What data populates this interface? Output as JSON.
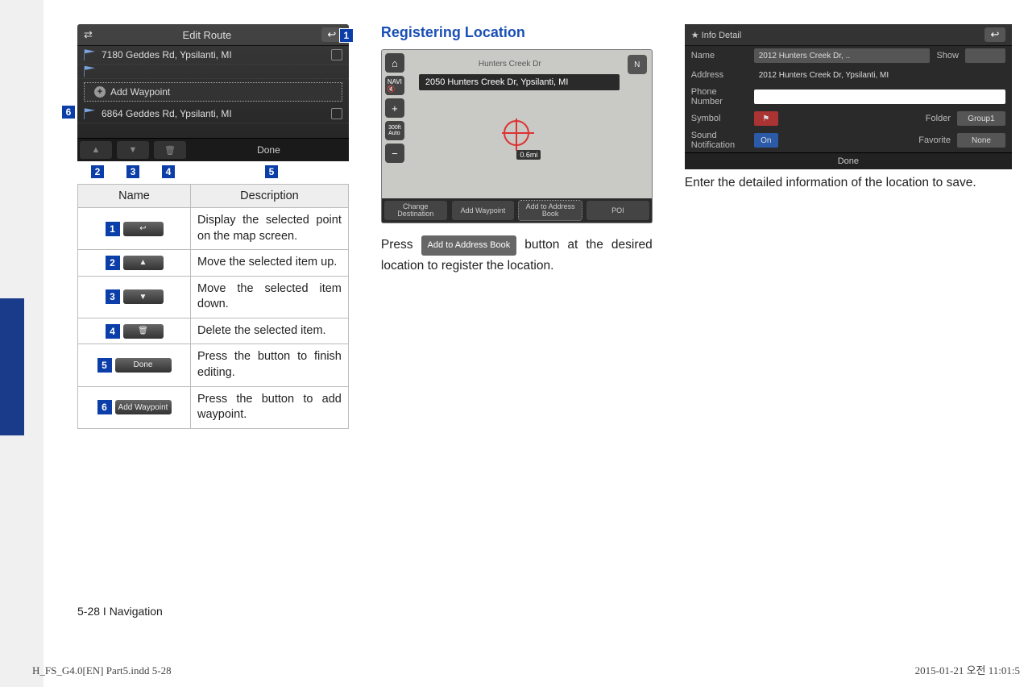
{
  "col1": {
    "edit_route": {
      "title": "Edit Route",
      "row1": "7180 Geddes Rd, Ypsilanti, MI",
      "add_waypoint": "Add Waypoint",
      "row3": "6864 Geddes Rd, Ypsilanti, MI",
      "done": "Done"
    },
    "callouts": {
      "c1": "1",
      "c2": "2",
      "c3": "3",
      "c4": "4",
      "c5": "5",
      "c6": "6"
    },
    "table": {
      "h_name": "Name",
      "h_desc": "Description",
      "rows": [
        {
          "n": "1",
          "btn_icon": "↩",
          "btn_text": "",
          "desc": "Display the selected point on the map screen."
        },
        {
          "n": "2",
          "btn_icon": "▲",
          "btn_text": "",
          "desc": "Move the selected item up."
        },
        {
          "n": "3",
          "btn_icon": "▼",
          "btn_text": "",
          "desc": "Move the selected item down."
        },
        {
          "n": "4",
          "btn_icon": "🗑",
          "btn_text": "",
          "desc": "Delete the selected item."
        },
        {
          "n": "5",
          "btn_icon": "",
          "btn_text": "Done",
          "desc": "Press the button to finish editing."
        },
        {
          "n": "6",
          "btn_icon": "",
          "btn_text": "Add Waypoint",
          "desc": "Press the button to add waypoint."
        }
      ]
    }
  },
  "col2": {
    "heading": "Registering Location",
    "map": {
      "road": "Hunters Creek Dr",
      "addr": "2050 Hunters Creek Dr, Ypsilanti, MI",
      "dist": "0.6mi",
      "buttons": {
        "b1": "Change Destination",
        "b2": "Add Waypoint",
        "b3": "Add to Address Book",
        "b4": "POI"
      }
    },
    "text_pre": "Press ",
    "inline_btn": "Add to Address Book",
    "text_post": " button at the desired location to register the location."
  },
  "col3": {
    "info": {
      "title": "Info Detail",
      "name_lbl": "Name",
      "name_val": "2012 Hunters Creek Dr, ..",
      "show_lbl": "Show",
      "addr_lbl": "Address",
      "addr_val": "2012 Hunters Creek Dr, Ypsilanti, MI",
      "phone_lbl": "Phone Number",
      "symbol_lbl": "Symbol",
      "folder_lbl": "Folder",
      "folder_val": "Group1",
      "sound_lbl": "Sound Notification",
      "on": "On",
      "fav_lbl": "Favorite",
      "fav_val": "None",
      "done": "Done"
    },
    "body": "Enter the detailed information of the location to save."
  },
  "footer": "5-28 I Navigation",
  "print_left": "H_FS_G4.0[EN] Part5.indd   5-28",
  "print_right": "2015-01-21   오전 11:01:5"
}
